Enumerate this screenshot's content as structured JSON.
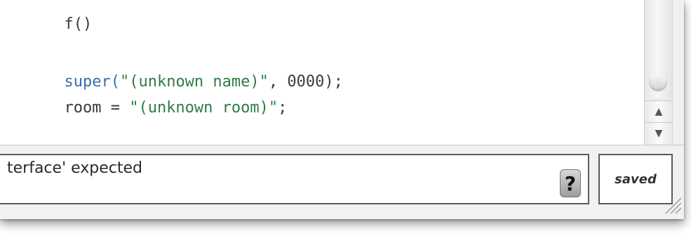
{
  "editor": {
    "lines": [
      {
        "parts": [
          "f()"
        ]
      },
      {
        "parts": [
          "super(",
          "\"(unknown name)\"",
          ", 0000);"
        ]
      },
      {
        "parts": [
          "room = ",
          "\"(unknown room)\"",
          ";"
        ]
      }
    ]
  },
  "scrollbar": {
    "up_icon": "arrow-up-icon",
    "down_icon": "arrow-down-icon",
    "up_glyph": "▲",
    "down_glyph": "▼"
  },
  "status": {
    "message": "terface' expected",
    "help_label": "?",
    "saved_label": "saved"
  },
  "colors": {
    "keyword": "#3b6ea8",
    "string": "#2f7a45",
    "text": "#3a3a3a"
  }
}
